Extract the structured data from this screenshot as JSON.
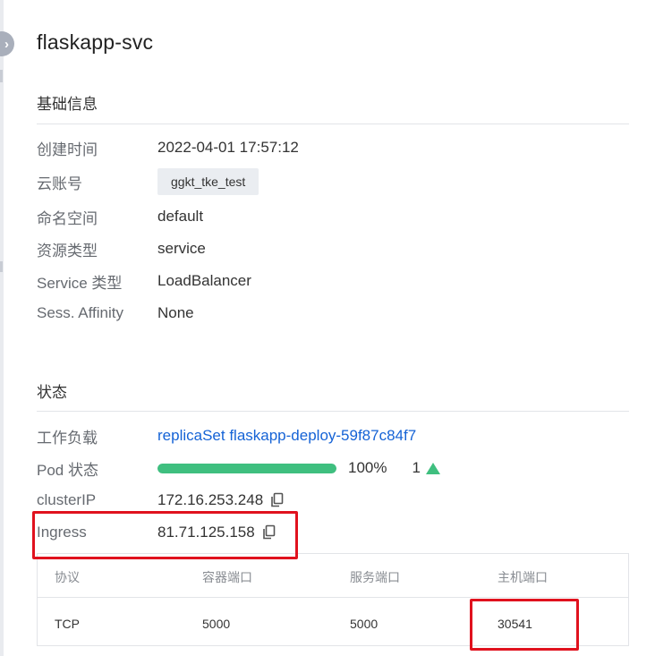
{
  "page": {
    "title": "flaskapp-svc"
  },
  "basic_info": {
    "title": "基础信息",
    "rows": [
      {
        "label": "创建时间",
        "value": "2022-04-01 17:57:12"
      },
      {
        "label": "云账号",
        "value": "ggkt_tke_test"
      },
      {
        "label": "命名空间",
        "value": "default"
      },
      {
        "label": "资源类型",
        "value": "service"
      },
      {
        "label": "Service 类型",
        "value": "LoadBalancer"
      },
      {
        "label": "Sess. Affinity",
        "value": "None"
      }
    ]
  },
  "status": {
    "title": "状态",
    "workload": {
      "label": "工作负载",
      "value": "replicaSet flaskapp-deploy-59f87c84f7"
    },
    "pod_status": {
      "label": "Pod 状态",
      "progress_percent": 100,
      "percent_text": "100%",
      "count": "1"
    },
    "cluster_ip": {
      "label": "clusterIP",
      "value": "172.16.253.248"
    },
    "ingress": {
      "label": "Ingress",
      "value": "81.71.125.158"
    }
  },
  "ports_table": {
    "headers": [
      "协议",
      "容器端口",
      "服务端口",
      "主机端口"
    ],
    "rows": [
      [
        "TCP",
        "5000",
        "5000",
        "30541"
      ]
    ]
  },
  "colors": {
    "link": "#1563d6",
    "progress": "#3fbf7f",
    "highlight_box": "#e0121e"
  },
  "icons": {
    "collapse": "chevron-right-icon",
    "copy": "copy-icon",
    "trend": "up-triangle-icon"
  }
}
